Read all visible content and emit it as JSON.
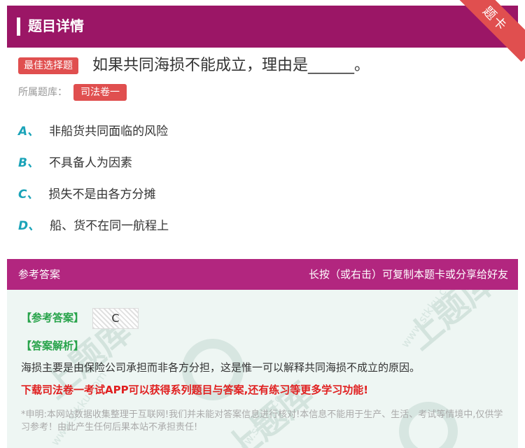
{
  "header": {
    "title": "题目详情"
  },
  "corner": {
    "label": "题卡"
  },
  "question": {
    "type_tag": "最佳选择题",
    "text": "如果共同海损不能成立，理由是______。",
    "bank_label": "所属题库：",
    "bank_tag": "司法卷一"
  },
  "options": [
    {
      "letter": "A、",
      "text": "非船货共同面临的风险"
    },
    {
      "letter": "B、",
      "text": "不具备人为因素"
    },
    {
      "letter": "C、",
      "text": "损失不是由各方分摊"
    },
    {
      "letter": "D、",
      "text": "船、货不在同一航程上"
    }
  ],
  "answer": {
    "title": "参考答案",
    "hint": "长按（或右击）可复制本题卡或分享给好友",
    "ref_label": "【参考答案】",
    "ref_value": "C",
    "analysis_label": "【答案解析】",
    "analysis_text": "海损主要是由保险公司承担而非各方分担，这是惟一可以解释共同海损不成立的原因。",
    "promo": "下载司法卷一考试APP可以获得系列题目与答案,还有练习等更多学习功能!",
    "disclaimer": "*申明:本网站数据收集整理于互联网!我们并未能对答案信息进行核对!本信息不能用于生产、生活、考试等情境中,仅供学习参考！由此产生任何后果本站不承担责任!"
  },
  "watermark": {
    "text": "www.stkku.com",
    "big": "上题库"
  },
  "colors": {
    "header_bg": "#9b1666",
    "answer_header_bg": "#b2267f",
    "tag_red": "#e04f4f",
    "option_letter": "#1aa3b8",
    "answer_green": "#27a34a",
    "promo_red": "#e02020"
  }
}
